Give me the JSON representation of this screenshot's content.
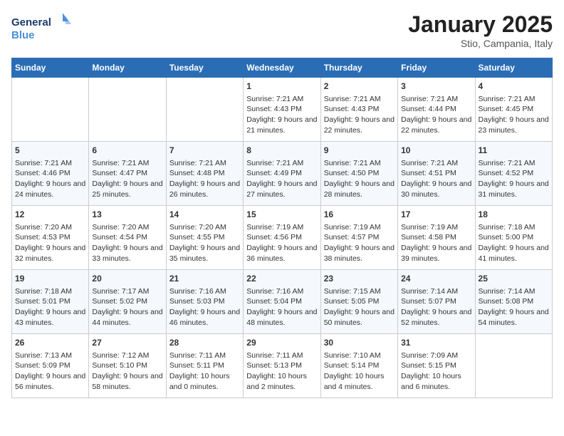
{
  "header": {
    "logo_general": "General",
    "logo_blue": "Blue",
    "month": "January 2025",
    "location": "Stio, Campania, Italy"
  },
  "days_of_week": [
    "Sunday",
    "Monday",
    "Tuesday",
    "Wednesday",
    "Thursday",
    "Friday",
    "Saturday"
  ],
  "weeks": [
    [
      {
        "day": "",
        "sunrise": "",
        "sunset": "",
        "daylight": ""
      },
      {
        "day": "",
        "sunrise": "",
        "sunset": "",
        "daylight": ""
      },
      {
        "day": "",
        "sunrise": "",
        "sunset": "",
        "daylight": ""
      },
      {
        "day": "1",
        "sunrise": "Sunrise: 7:21 AM",
        "sunset": "Sunset: 4:43 PM",
        "daylight": "Daylight: 9 hours and 21 minutes."
      },
      {
        "day": "2",
        "sunrise": "Sunrise: 7:21 AM",
        "sunset": "Sunset: 4:43 PM",
        "daylight": "Daylight: 9 hours and 22 minutes."
      },
      {
        "day": "3",
        "sunrise": "Sunrise: 7:21 AM",
        "sunset": "Sunset: 4:44 PM",
        "daylight": "Daylight: 9 hours and 22 minutes."
      },
      {
        "day": "4",
        "sunrise": "Sunrise: 7:21 AM",
        "sunset": "Sunset: 4:45 PM",
        "daylight": "Daylight: 9 hours and 23 minutes."
      }
    ],
    [
      {
        "day": "5",
        "sunrise": "Sunrise: 7:21 AM",
        "sunset": "Sunset: 4:46 PM",
        "daylight": "Daylight: 9 hours and 24 minutes."
      },
      {
        "day": "6",
        "sunrise": "Sunrise: 7:21 AM",
        "sunset": "Sunset: 4:47 PM",
        "daylight": "Daylight: 9 hours and 25 minutes."
      },
      {
        "day": "7",
        "sunrise": "Sunrise: 7:21 AM",
        "sunset": "Sunset: 4:48 PM",
        "daylight": "Daylight: 9 hours and 26 minutes."
      },
      {
        "day": "8",
        "sunrise": "Sunrise: 7:21 AM",
        "sunset": "Sunset: 4:49 PM",
        "daylight": "Daylight: 9 hours and 27 minutes."
      },
      {
        "day": "9",
        "sunrise": "Sunrise: 7:21 AM",
        "sunset": "Sunset: 4:50 PM",
        "daylight": "Daylight: 9 hours and 28 minutes."
      },
      {
        "day": "10",
        "sunrise": "Sunrise: 7:21 AM",
        "sunset": "Sunset: 4:51 PM",
        "daylight": "Daylight: 9 hours and 30 minutes."
      },
      {
        "day": "11",
        "sunrise": "Sunrise: 7:21 AM",
        "sunset": "Sunset: 4:52 PM",
        "daylight": "Daylight: 9 hours and 31 minutes."
      }
    ],
    [
      {
        "day": "12",
        "sunrise": "Sunrise: 7:20 AM",
        "sunset": "Sunset: 4:53 PM",
        "daylight": "Daylight: 9 hours and 32 minutes."
      },
      {
        "day": "13",
        "sunrise": "Sunrise: 7:20 AM",
        "sunset": "Sunset: 4:54 PM",
        "daylight": "Daylight: 9 hours and 33 minutes."
      },
      {
        "day": "14",
        "sunrise": "Sunrise: 7:20 AM",
        "sunset": "Sunset: 4:55 PM",
        "daylight": "Daylight: 9 hours and 35 minutes."
      },
      {
        "day": "15",
        "sunrise": "Sunrise: 7:19 AM",
        "sunset": "Sunset: 4:56 PM",
        "daylight": "Daylight: 9 hours and 36 minutes."
      },
      {
        "day": "16",
        "sunrise": "Sunrise: 7:19 AM",
        "sunset": "Sunset: 4:57 PM",
        "daylight": "Daylight: 9 hours and 38 minutes."
      },
      {
        "day": "17",
        "sunrise": "Sunrise: 7:19 AM",
        "sunset": "Sunset: 4:58 PM",
        "daylight": "Daylight: 9 hours and 39 minutes."
      },
      {
        "day": "18",
        "sunrise": "Sunrise: 7:18 AM",
        "sunset": "Sunset: 5:00 PM",
        "daylight": "Daylight: 9 hours and 41 minutes."
      }
    ],
    [
      {
        "day": "19",
        "sunrise": "Sunrise: 7:18 AM",
        "sunset": "Sunset: 5:01 PM",
        "daylight": "Daylight: 9 hours and 43 minutes."
      },
      {
        "day": "20",
        "sunrise": "Sunrise: 7:17 AM",
        "sunset": "Sunset: 5:02 PM",
        "daylight": "Daylight: 9 hours and 44 minutes."
      },
      {
        "day": "21",
        "sunrise": "Sunrise: 7:16 AM",
        "sunset": "Sunset: 5:03 PM",
        "daylight": "Daylight: 9 hours and 46 minutes."
      },
      {
        "day": "22",
        "sunrise": "Sunrise: 7:16 AM",
        "sunset": "Sunset: 5:04 PM",
        "daylight": "Daylight: 9 hours and 48 minutes."
      },
      {
        "day": "23",
        "sunrise": "Sunrise: 7:15 AM",
        "sunset": "Sunset: 5:05 PM",
        "daylight": "Daylight: 9 hours and 50 minutes."
      },
      {
        "day": "24",
        "sunrise": "Sunrise: 7:14 AM",
        "sunset": "Sunset: 5:07 PM",
        "daylight": "Daylight: 9 hours and 52 minutes."
      },
      {
        "day": "25",
        "sunrise": "Sunrise: 7:14 AM",
        "sunset": "Sunset: 5:08 PM",
        "daylight": "Daylight: 9 hours and 54 minutes."
      }
    ],
    [
      {
        "day": "26",
        "sunrise": "Sunrise: 7:13 AM",
        "sunset": "Sunset: 5:09 PM",
        "daylight": "Daylight: 9 hours and 56 minutes."
      },
      {
        "day": "27",
        "sunrise": "Sunrise: 7:12 AM",
        "sunset": "Sunset: 5:10 PM",
        "daylight": "Daylight: 9 hours and 58 minutes."
      },
      {
        "day": "28",
        "sunrise": "Sunrise: 7:11 AM",
        "sunset": "Sunset: 5:11 PM",
        "daylight": "Daylight: 10 hours and 0 minutes."
      },
      {
        "day": "29",
        "sunrise": "Sunrise: 7:11 AM",
        "sunset": "Sunset: 5:13 PM",
        "daylight": "Daylight: 10 hours and 2 minutes."
      },
      {
        "day": "30",
        "sunrise": "Sunrise: 7:10 AM",
        "sunset": "Sunset: 5:14 PM",
        "daylight": "Daylight: 10 hours and 4 minutes."
      },
      {
        "day": "31",
        "sunrise": "Sunrise: 7:09 AM",
        "sunset": "Sunset: 5:15 PM",
        "daylight": "Daylight: 10 hours and 6 minutes."
      },
      {
        "day": "",
        "sunrise": "",
        "sunset": "",
        "daylight": ""
      }
    ]
  ]
}
